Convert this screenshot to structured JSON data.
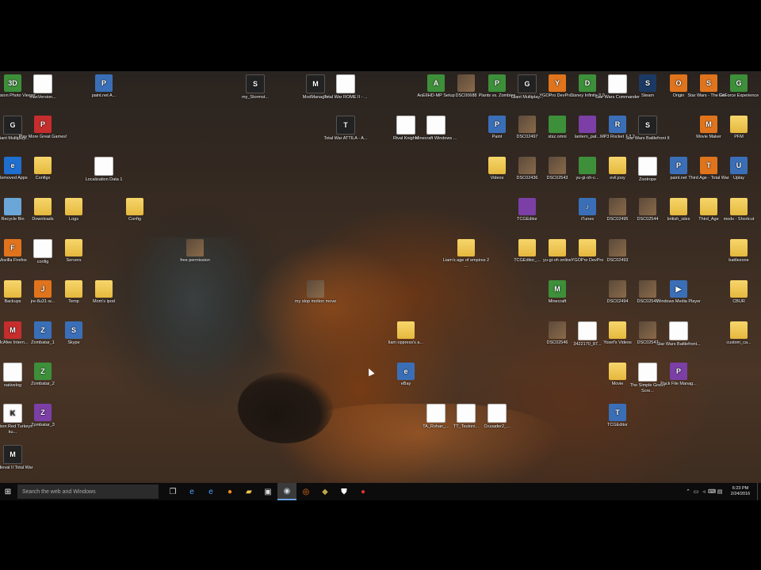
{
  "desktop": {
    "icons": [
      {
        "label": "3D Vision Photo Viewer",
        "kind": "app-green",
        "glyph": "3D",
        "icon": "3d-vision-icon"
      },
      {
        "label": "maxVersion...",
        "kind": "doc",
        "glyph": "",
        "icon": "document-icon"
      },
      {
        "label": "paint.net A...",
        "kind": "app",
        "glyph": "P",
        "icon": "paint-net-icon"
      },
      {
        "label": "my_Stormst...",
        "kind": "app-dark",
        "glyph": "S",
        "icon": "game-icon"
      },
      {
        "label": "ModManager",
        "kind": "app-dark",
        "glyph": "M",
        "icon": "mod-manager-icon"
      },
      {
        "label": "Total War ROME II - ...",
        "kind": "doc",
        "glyph": "",
        "icon": "document-icon"
      },
      {
        "label": "AoEIIHD-MP Setup",
        "kind": "app-green",
        "glyph": "A",
        "icon": "setup-icon"
      },
      {
        "label": "DSC00688",
        "kind": "app-photo",
        "glyph": "",
        "icon": "photo-icon"
      },
      {
        "label": "Plants vs. Zombies",
        "kind": "app-green",
        "glyph": "P",
        "icon": "pvz-icon"
      },
      {
        "label": "Giant Multiplay...",
        "kind": "app-dark",
        "glyph": "G",
        "icon": "game-icon"
      },
      {
        "label": "YGOPro DevPro...",
        "kind": "app-orange",
        "glyph": "Y",
        "icon": "ygopro-icon"
      },
      {
        "label": "Disney Infinity 3.0",
        "kind": "app-green",
        "glyph": "D",
        "icon": "disney-infinity-icon"
      },
      {
        "label": "Star Wars Commander",
        "kind": "doc",
        "glyph": "",
        "icon": "document-icon"
      },
      {
        "label": "Steam",
        "kind": "app-steam",
        "glyph": "S",
        "icon": "steam-icon"
      },
      {
        "label": "Origin",
        "kind": "app-orange",
        "glyph": "O",
        "icon": "origin-icon"
      },
      {
        "label": "Star Wars - The Old...",
        "kind": "app-orange",
        "glyph": "S",
        "icon": "game-icon"
      },
      {
        "label": "GeForce Experience",
        "kind": "app-green",
        "glyph": "G",
        "icon": "geforce-icon"
      },
      {
        "label": "Giant Multiplay...",
        "kind": "app-dark",
        "glyph": "G",
        "icon": "game-icon"
      },
      {
        "label": "Play More Great Games!",
        "kind": "app-red",
        "glyph": "P",
        "icon": "play-games-icon"
      },
      {
        "label": "Total War ATTILA - A...",
        "kind": "app-dark",
        "glyph": "T",
        "icon": "game-icon"
      },
      {
        "label": "Rival Knights",
        "kind": "doc",
        "glyph": "",
        "icon": "document-icon"
      },
      {
        "label": "Minecraft Windows ...",
        "kind": "doc",
        "glyph": "",
        "icon": "document-icon"
      },
      {
        "label": "Paint",
        "kind": "app",
        "glyph": "P",
        "icon": "paint-icon"
      },
      {
        "label": "DSC02497",
        "kind": "app-photo",
        "glyph": "",
        "icon": "photo-icon"
      },
      {
        "label": "stsz.omni",
        "kind": "app-green",
        "glyph": "",
        "icon": "file-icon"
      },
      {
        "label": "lantern_pat...",
        "kind": "app-purple",
        "glyph": "",
        "icon": "file-icon"
      },
      {
        "label": "MP3 Rocket 7.3.2",
        "kind": "app",
        "glyph": "R",
        "icon": "mp3-rocket-icon"
      },
      {
        "label": "Star Wars Battlefront II",
        "kind": "app-dark",
        "glyph": "S",
        "icon": "game-icon"
      },
      {
        "label": "Movie Maker",
        "kind": "app-orange",
        "glyph": "M",
        "icon": "movie-maker-icon"
      },
      {
        "label": "PFM",
        "kind": "folder",
        "glyph": "",
        "icon": "folder-icon"
      },
      {
        "label": "Removed Apps",
        "kind": "app-edge",
        "glyph": "e",
        "icon": "edge-icon"
      },
      {
        "label": "Configs",
        "kind": "folder",
        "glyph": "",
        "icon": "folder-icon"
      },
      {
        "label": "Localization Data 1",
        "kind": "doc",
        "glyph": "",
        "icon": "file-icon"
      },
      {
        "label": "Videos",
        "kind": "folder",
        "glyph": "",
        "icon": "folder-icon"
      },
      {
        "label": "DSC02436",
        "kind": "app-photo",
        "glyph": "",
        "icon": "photo-icon"
      },
      {
        "label": "DSC02543",
        "kind": "app-photo",
        "glyph": "",
        "icon": "photo-icon"
      },
      {
        "label": "yu-gi-oh-c...",
        "kind": "app-green",
        "glyph": "",
        "icon": "file-icon"
      },
      {
        "label": "evil.josy",
        "kind": "folder",
        "glyph": "",
        "icon": "folder-icon"
      },
      {
        "label": "Zootrope",
        "kind": "doc",
        "glyph": "",
        "icon": "document-icon"
      },
      {
        "label": "paint.net",
        "kind": "app",
        "glyph": "P",
        "icon": "paint-net-icon"
      },
      {
        "label": "Third Age - Total War",
        "kind": "app-orange",
        "glyph": "T",
        "icon": "game-icon"
      },
      {
        "label": "Uplay",
        "kind": "app",
        "glyph": "U",
        "icon": "uplay-icon"
      },
      {
        "label": "Recycle Bin",
        "kind": "app-recycle",
        "glyph": "",
        "icon": "recycle-bin-icon"
      },
      {
        "label": "Downloads",
        "kind": "folder",
        "glyph": "",
        "icon": "folder-icon"
      },
      {
        "label": "Logs",
        "kind": "folder",
        "glyph": "",
        "icon": "folder-icon"
      },
      {
        "label": "Config",
        "kind": "folder",
        "glyph": "",
        "icon": "folder-icon"
      },
      {
        "label": "TCGEditor",
        "kind": "app-purple",
        "glyph": "",
        "icon": "file-icon"
      },
      {
        "label": "iTunes",
        "kind": "app",
        "glyph": "♪",
        "icon": "itunes-icon"
      },
      {
        "label": "DSC02495",
        "kind": "app-photo",
        "glyph": "",
        "icon": "photo-icon"
      },
      {
        "label": "DSC02544",
        "kind": "app-photo",
        "glyph": "",
        "icon": "photo-icon"
      },
      {
        "label": "british_isles",
        "kind": "folder",
        "glyph": "",
        "icon": "folder-icon"
      },
      {
        "label": "Third_Age",
        "kind": "folder",
        "glyph": "",
        "icon": "folder-icon"
      },
      {
        "label": "mods - Shortcut",
        "kind": "folder",
        "glyph": "",
        "icon": "folder-icon"
      },
      {
        "label": "Mozilla Firefox",
        "kind": "app-orange",
        "glyph": "F",
        "icon": "firefox-icon"
      },
      {
        "label": "config",
        "kind": "doc",
        "glyph": "",
        "icon": "document-icon"
      },
      {
        "label": "Servers",
        "kind": "folder",
        "glyph": "",
        "icon": "folder-icon"
      },
      {
        "label": "free permission",
        "kind": "app-photo",
        "glyph": "",
        "icon": "photo-icon"
      },
      {
        "label": "Liam's age of empires 2 ...",
        "kind": "folder",
        "glyph": "",
        "icon": "folder-icon"
      },
      {
        "label": "TCGEditor_...",
        "kind": "folder",
        "glyph": "",
        "icon": "folder-icon"
      },
      {
        "label": "yu-gi-oh online",
        "kind": "folder",
        "glyph": "",
        "icon": "folder-icon"
      },
      {
        "label": "YGOPro DevPro",
        "kind": "folder",
        "glyph": "",
        "icon": "folder-icon"
      },
      {
        "label": "DSC02493",
        "kind": "app-photo",
        "glyph": "",
        "icon": "photo-icon"
      },
      {
        "label": "battlezone",
        "kind": "folder",
        "glyph": "",
        "icon": "folder-icon"
      },
      {
        "label": "Backups",
        "kind": "folder",
        "glyph": "",
        "icon": "folder-icon"
      },
      {
        "label": "jre-8u31-w...",
        "kind": "app-orange",
        "glyph": "J",
        "icon": "java-icon"
      },
      {
        "label": "Temp",
        "kind": "folder",
        "glyph": "",
        "icon": "folder-icon"
      },
      {
        "label": "Mom's ipod",
        "kind": "folder",
        "glyph": "",
        "icon": "folder-icon"
      },
      {
        "label": "my stop motion move",
        "kind": "app-photo",
        "glyph": "",
        "icon": "video-icon"
      },
      {
        "label": "Minecraft",
        "kind": "app-green",
        "glyph": "M",
        "icon": "minecraft-icon"
      },
      {
        "label": "DSC02494",
        "kind": "app-photo",
        "glyph": "",
        "icon": "photo-icon"
      },
      {
        "label": "DSC02545",
        "kind": "app-photo",
        "glyph": "",
        "icon": "photo-icon"
      },
      {
        "label": "Windows Media Player",
        "kind": "app",
        "glyph": "▶",
        "icon": "media-player-icon"
      },
      {
        "label": "CBUR",
        "kind": "folder",
        "glyph": "",
        "icon": "folder-icon"
      },
      {
        "label": "McAfee Intern...",
        "kind": "app-red",
        "glyph": "M",
        "icon": "mcafee-icon"
      },
      {
        "label": "Zombatar_1",
        "kind": "app",
        "glyph": "Z",
        "icon": "zombatar-icon"
      },
      {
        "label": "Skype",
        "kind": "app",
        "glyph": "S",
        "icon": "skype-icon"
      },
      {
        "label": "liam oppress's a...",
        "kind": "folder",
        "glyph": "",
        "icon": "folder-icon"
      },
      {
        "label": "DSC02546",
        "kind": "app-photo",
        "glyph": "",
        "icon": "photo-icon"
      },
      {
        "label": "3422170_87...",
        "kind": "doc",
        "glyph": "",
        "icon": "document-icon"
      },
      {
        "label": "Yosef's Videos",
        "kind": "folder",
        "glyph": "",
        "icon": "folder-icon"
      },
      {
        "label": "DSC02547",
        "kind": "app-photo",
        "glyph": "",
        "icon": "photo-icon"
      },
      {
        "label": "Star Wars Battlefront...",
        "kind": "doc",
        "glyph": "",
        "icon": "document-icon"
      },
      {
        "label": "custom_ca...",
        "kind": "folder",
        "glyph": "",
        "icon": "folder-icon"
      },
      {
        "label": "nativelog",
        "kind": "doc",
        "glyph": "",
        "icon": "document-icon"
      },
      {
        "label": "Zombatar_2",
        "kind": "app-green",
        "glyph": "Z",
        "icon": "zombatar-icon"
      },
      {
        "label": "eBay",
        "kind": "app",
        "glyph": "e",
        "icon": "ebay-icon"
      },
      {
        "label": "Movie",
        "kind": "folder",
        "glyph": "",
        "icon": "folder-icon"
      },
      {
        "label": "The Simple Green Scre...",
        "kind": "doc",
        "glyph": "",
        "icon": "document-icon"
      },
      {
        "label": "Pack File Manag...",
        "kind": "app-purple",
        "glyph": "P",
        "icon": "pack-file-manager-icon"
      },
      {
        "label": "Bourbon Red Turkeys - ku...",
        "kind": "doc",
        "glyph": "K",
        "icon": "document-icon"
      },
      {
        "label": "Zombatar_3",
        "kind": "app-purple",
        "glyph": "Z",
        "icon": "zombatar-icon"
      },
      {
        "label": "TA_Rohan_...",
        "kind": "doc",
        "glyph": "",
        "icon": "document-icon"
      },
      {
        "label": "TT_Teutoni...",
        "kind": "doc",
        "glyph": "",
        "icon": "document-icon"
      },
      {
        "label": "Crusader2_...",
        "kind": "doc",
        "glyph": "",
        "icon": "document-icon"
      },
      {
        "label": "TCGEditor",
        "kind": "app",
        "glyph": "T",
        "icon": "tcgeditor-icon"
      },
      {
        "label": "Medieval II Total War",
        "kind": "app-dark",
        "glyph": "M",
        "icon": "game-icon"
      }
    ]
  },
  "taskbar": {
    "search_placeholder": "Search the web and Windows",
    "pinned": [
      {
        "icon": "task-view-icon",
        "glyph": "❐",
        "color": "#dddddd",
        "active": false
      },
      {
        "icon": "edge-icon",
        "glyph": "e",
        "color": "#4aa3ff",
        "active": false
      },
      {
        "icon": "internet-explorer-icon",
        "glyph": "e",
        "color": "#4aa3ff",
        "active": false
      },
      {
        "icon": "firefox-icon",
        "glyph": "●",
        "color": "#ff8a1f",
        "active": false
      },
      {
        "icon": "file-explorer-icon",
        "glyph": "▰",
        "color": "#f2c94c",
        "active": false
      },
      {
        "icon": "store-icon",
        "glyph": "▣",
        "color": "#dddddd",
        "active": false
      },
      {
        "icon": "steam-icon",
        "glyph": "◉",
        "color": "#cfd8e3",
        "active": true
      },
      {
        "icon": "origin-icon",
        "glyph": "◎",
        "color": "#ff7a1a",
        "active": false
      },
      {
        "icon": "game-icon",
        "glyph": "◆",
        "color": "#bfa64a",
        "active": false
      },
      {
        "icon": "mcafee-shield-icon",
        "glyph": "⛊",
        "color": "#ffffff",
        "active": false
      },
      {
        "icon": "record-icon",
        "glyph": "●",
        "color": "#e03030",
        "active": false
      }
    ],
    "tray": {
      "icons": [
        "up-arrow-icon",
        "network-icon",
        "volume-icon",
        "keyboard-icon",
        "notification-icon"
      ],
      "time": "6:23 PM",
      "date": "2/24/2016"
    }
  }
}
